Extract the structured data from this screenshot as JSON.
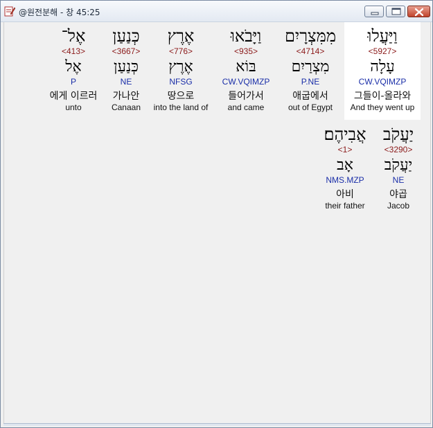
{
  "window": {
    "title": "@원전분해 - 창 45:25",
    "app_icon": "notebook-pencil-icon",
    "controls": [
      "minimize-icon",
      "maximize-icon",
      "close-icon"
    ],
    "accent_close": "#c0432c"
  },
  "verse_rows": [
    [
      {
        "heb": "וַיַּעֲלוּ",
        "strong": "<5927>",
        "lemma": "עָלָה",
        "morph": "CW.VQIMZP",
        "kor": "그들이-올라와",
        "eng": "And they went up",
        "highlight": true
      },
      {
        "heb": "מִמִּצְרָיִם",
        "strong": "<4714>",
        "lemma": "מִצְרַיִם",
        "morph": "P.NE",
        "kor": "애굽에서",
        "eng": "out of Egypt",
        "highlight": false
      },
      {
        "heb": "וַיָּבֹאוּ",
        "strong": "<935>",
        "lemma": "בּוֹא",
        "morph": "CW.VQIMZP",
        "kor": "들어가서",
        "eng": "and came",
        "highlight": false
      },
      {
        "heb": "אֶרֶץ",
        "strong": "<776>",
        "lemma": "אֶרֶץ",
        "morph": "NFSG",
        "kor": "땅으로",
        "eng": "into the land of",
        "highlight": false
      },
      {
        "heb": "כְּנַעַן",
        "strong": "<3667>",
        "lemma": "כְּנַעַן",
        "morph": "NE",
        "kor": "가나안",
        "eng": "Canaan",
        "highlight": false
      },
      {
        "heb": "אֶל־",
        "strong": "<413>",
        "lemma": "אֶל",
        "morph": "P",
        "kor": "에게 이르러",
        "eng": "unto",
        "highlight": false
      }
    ],
    [
      {
        "heb": "יַעֲקֹב",
        "strong": "<3290>",
        "lemma": "יַעֲקֹב",
        "morph": "NE",
        "kor": "야곱",
        "eng": "Jacob",
        "highlight": false
      },
      {
        "heb": "אֲבִיהֶם׃",
        "strong": "<1>",
        "lemma": "אָב",
        "morph": "NMS.MZP",
        "kor": "아비",
        "eng": "their father",
        "highlight": false
      }
    ]
  ]
}
